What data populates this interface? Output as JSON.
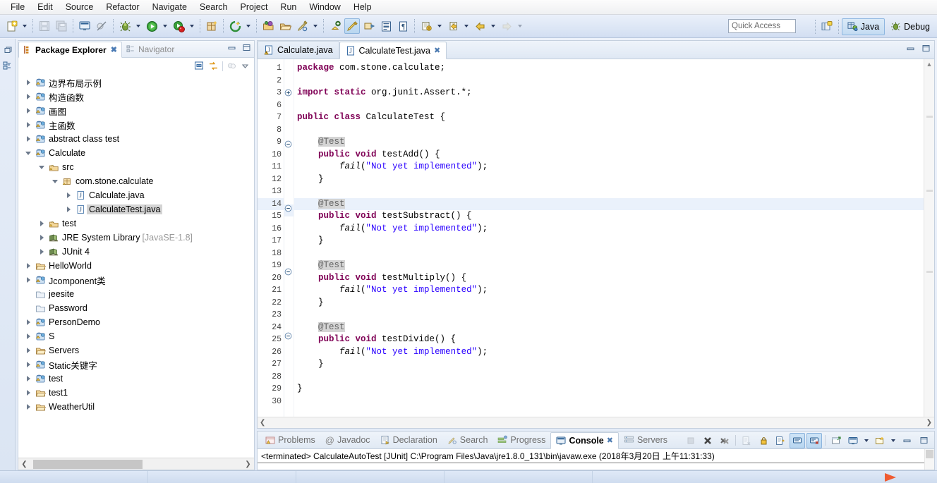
{
  "menubar": {
    "items": [
      {
        "label": "File"
      },
      {
        "label": "Edit"
      },
      {
        "label": "Source"
      },
      {
        "label": "Refactor"
      },
      {
        "label": "Navigate"
      },
      {
        "label": "Search"
      },
      {
        "label": "Project"
      },
      {
        "label": "Run"
      },
      {
        "label": "Window"
      },
      {
        "label": "Help"
      }
    ]
  },
  "toolbar": {
    "quick_access_placeholder": "Quick Access",
    "perspectives": [
      {
        "label": "Java",
        "icon": "java-perspective-icon",
        "active": true
      },
      {
        "label": "Debug",
        "icon": "debug-perspective-icon",
        "active": false
      }
    ],
    "open_perspective_icon": "open-perspective-icon",
    "buttons": [
      {
        "name": "new-wizard-icon"
      },
      {
        "name": "save-icon"
      },
      {
        "name": "save-all-icon"
      },
      {
        "name": "new-java-console-icon"
      },
      {
        "name": "skip-all-breakpoints-icon"
      },
      {
        "name": "debug-icon"
      },
      {
        "name": "run-icon"
      },
      {
        "name": "run-coverage-icon"
      },
      {
        "name": "new-java-package-icon"
      },
      {
        "name": "external-tools-icon"
      },
      {
        "name": "open-type-icon"
      },
      {
        "name": "open-task-icon"
      },
      {
        "name": "search-icon"
      },
      {
        "name": "next-annotation-icon"
      },
      {
        "name": "toggle-mark-occurrences-icon"
      },
      {
        "name": "toggle-block-selection-icon"
      },
      {
        "name": "show-whitespace-icon"
      },
      {
        "name": "pin-editor-icon"
      },
      {
        "name": "last-edit-location-icon"
      },
      {
        "name": "back-icon"
      },
      {
        "name": "forward-icon"
      }
    ]
  },
  "package_explorer": {
    "tabs": [
      {
        "label": "Package Explorer",
        "active": true,
        "icon": "package-explorer-icon"
      },
      {
        "label": "Navigator",
        "active": false,
        "icon": "navigator-icon"
      }
    ],
    "view_controls": [
      {
        "name": "minimize-view-icon"
      },
      {
        "name": "maximize-view-icon"
      }
    ],
    "toolbar_buttons": [
      {
        "name": "collapse-all-icon"
      },
      {
        "name": "link-with-editor-icon"
      },
      {
        "name": "focus-on-active-task-icon"
      },
      {
        "name": "view-menu-icon"
      }
    ],
    "tree": [
      {
        "label": "边界布局示例",
        "depth": 0,
        "state": "collapsed",
        "icon": "java-project-icon"
      },
      {
        "label": "构造函数",
        "depth": 0,
        "state": "collapsed",
        "icon": "java-project-icon"
      },
      {
        "label": "画图",
        "depth": 0,
        "state": "collapsed",
        "icon": "java-project-icon"
      },
      {
        "label": "主函数",
        "depth": 0,
        "state": "collapsed",
        "icon": "java-project-icon"
      },
      {
        "label": "abstract class test",
        "depth": 0,
        "state": "collapsed",
        "icon": "java-project-icon"
      },
      {
        "label": "Calculate",
        "depth": 0,
        "state": "expanded",
        "icon": "java-project-icon"
      },
      {
        "label": "src",
        "depth": 1,
        "state": "expanded",
        "icon": "source-folder-icon"
      },
      {
        "label": "com.stone.calculate",
        "depth": 2,
        "state": "expanded",
        "icon": "package-icon"
      },
      {
        "label": "Calculate.java",
        "depth": 3,
        "state": "collapsed",
        "icon": "java-file-icon"
      },
      {
        "label": "CalculateTest.java",
        "depth": 3,
        "state": "collapsed",
        "icon": "java-file-icon",
        "selected": true
      },
      {
        "label": "test",
        "depth": 1,
        "state": "collapsed",
        "icon": "source-folder-icon"
      },
      {
        "label": "JRE System Library",
        "suffix": "[JavaSE-1.8]",
        "depth": 1,
        "state": "collapsed",
        "icon": "library-icon"
      },
      {
        "label": "JUnit 4",
        "depth": 1,
        "state": "collapsed",
        "icon": "library-icon"
      },
      {
        "label": "HelloWorld",
        "depth": 0,
        "state": "collapsed",
        "icon": "project-icon"
      },
      {
        "label": "Jcomponent类",
        "depth": 0,
        "state": "collapsed",
        "icon": "java-project-icon"
      },
      {
        "label": "jeesite",
        "depth": 0,
        "state": "none",
        "icon": "closed-project-icon"
      },
      {
        "label": "Password",
        "depth": 0,
        "state": "none",
        "icon": "closed-project-icon"
      },
      {
        "label": "PersonDemo",
        "depth": 0,
        "state": "collapsed",
        "icon": "java-project-icon"
      },
      {
        "label": "S",
        "depth": 0,
        "state": "collapsed",
        "icon": "java-project-icon"
      },
      {
        "label": "Servers",
        "depth": 0,
        "state": "collapsed",
        "icon": "project-icon"
      },
      {
        "label": "Static关键字",
        "depth": 0,
        "state": "collapsed",
        "icon": "java-project-icon"
      },
      {
        "label": "test",
        "depth": 0,
        "state": "collapsed",
        "icon": "java-project-icon"
      },
      {
        "label": "test1",
        "depth": 0,
        "state": "collapsed",
        "icon": "project-icon"
      },
      {
        "label": "WeatherUtil",
        "depth": 0,
        "state": "collapsed",
        "icon": "project-icon"
      }
    ]
  },
  "editor": {
    "tabs": [
      {
        "label": "Calculate.java",
        "active": false,
        "icon": "java-file-warning-icon",
        "closable": false
      },
      {
        "label": "CalculateTest.java",
        "active": true,
        "icon": "java-file-icon",
        "closable": true
      }
    ],
    "controls": [
      {
        "name": "minimize-editor-icon"
      },
      {
        "name": "maximize-editor-icon"
      }
    ],
    "lines": [
      {
        "num": "1",
        "fold": "",
        "highlight": false,
        "tokens": [
          {
            "t": "package ",
            "c": "kw"
          },
          {
            "t": "com.stone.calculate;",
            "c": "plain"
          }
        ]
      },
      {
        "num": "2",
        "fold": "",
        "highlight": false,
        "tokens": []
      },
      {
        "num": "3",
        "fold": "+",
        "highlight": false,
        "tokens": [
          {
            "t": "import static ",
            "c": "kw"
          },
          {
            "t": "org.junit.Assert.*;",
            "c": "plain"
          }
        ]
      },
      {
        "num": "6",
        "fold": "",
        "highlight": false,
        "tokens": []
      },
      {
        "num": "7",
        "fold": "",
        "highlight": false,
        "tokens": [
          {
            "t": "public class ",
            "c": "kw"
          },
          {
            "t": "CalculateTest {",
            "c": "plain"
          }
        ]
      },
      {
        "num": "8",
        "fold": "",
        "highlight": false,
        "tokens": []
      },
      {
        "num": "9",
        "fold": "-",
        "highlight": false,
        "tokens": [
          {
            "t": "    ",
            "c": "plain"
          },
          {
            "t": "@Test",
            "c": "ann"
          }
        ]
      },
      {
        "num": "10",
        "fold": "",
        "highlight": false,
        "tokens": [
          {
            "t": "    ",
            "c": "plain"
          },
          {
            "t": "public void ",
            "c": "kw"
          },
          {
            "t": "testAdd() {",
            "c": "plain"
          }
        ]
      },
      {
        "num": "11",
        "fold": "",
        "highlight": false,
        "tokens": [
          {
            "t": "        ",
            "c": "plain"
          },
          {
            "t": "fail",
            "c": "mth"
          },
          {
            "t": "(",
            "c": "plain"
          },
          {
            "t": "\"Not yet implemented\"",
            "c": "str"
          },
          {
            "t": ");",
            "c": "plain"
          }
        ]
      },
      {
        "num": "12",
        "fold": "",
        "highlight": false,
        "tokens": [
          {
            "t": "    }",
            "c": "plain"
          }
        ]
      },
      {
        "num": "13",
        "fold": "",
        "highlight": false,
        "tokens": []
      },
      {
        "num": "14",
        "fold": "-",
        "highlight": true,
        "tokens": [
          {
            "t": "    ",
            "c": "plain"
          },
          {
            "t": "@Test",
            "c": "ann"
          }
        ]
      },
      {
        "num": "15",
        "fold": "",
        "highlight": false,
        "tokens": [
          {
            "t": "    ",
            "c": "plain"
          },
          {
            "t": "public void ",
            "c": "kw"
          },
          {
            "t": "testSubstract() {",
            "c": "plain"
          }
        ]
      },
      {
        "num": "16",
        "fold": "",
        "highlight": false,
        "tokens": [
          {
            "t": "        ",
            "c": "plain"
          },
          {
            "t": "fail",
            "c": "mth"
          },
          {
            "t": "(",
            "c": "plain"
          },
          {
            "t": "\"Not yet implemented\"",
            "c": "str"
          },
          {
            "t": ");",
            "c": "plain"
          }
        ]
      },
      {
        "num": "17",
        "fold": "",
        "highlight": false,
        "tokens": [
          {
            "t": "    }",
            "c": "plain"
          }
        ]
      },
      {
        "num": "18",
        "fold": "",
        "highlight": false,
        "tokens": []
      },
      {
        "num": "19",
        "fold": "-",
        "highlight": false,
        "tokens": [
          {
            "t": "    ",
            "c": "plain"
          },
          {
            "t": "@Test",
            "c": "ann"
          }
        ]
      },
      {
        "num": "20",
        "fold": "",
        "highlight": false,
        "tokens": [
          {
            "t": "    ",
            "c": "plain"
          },
          {
            "t": "public void ",
            "c": "kw"
          },
          {
            "t": "testMultiply() {",
            "c": "plain"
          }
        ]
      },
      {
        "num": "21",
        "fold": "",
        "highlight": false,
        "tokens": [
          {
            "t": "        ",
            "c": "plain"
          },
          {
            "t": "fail",
            "c": "mth"
          },
          {
            "t": "(",
            "c": "plain"
          },
          {
            "t": "\"Not yet implemented\"",
            "c": "str"
          },
          {
            "t": ");",
            "c": "plain"
          }
        ]
      },
      {
        "num": "22",
        "fold": "",
        "highlight": false,
        "tokens": [
          {
            "t": "    }",
            "c": "plain"
          }
        ]
      },
      {
        "num": "23",
        "fold": "",
        "highlight": false,
        "tokens": []
      },
      {
        "num": "24",
        "fold": "-",
        "highlight": false,
        "tokens": [
          {
            "t": "    ",
            "c": "plain"
          },
          {
            "t": "@Test",
            "c": "ann"
          }
        ]
      },
      {
        "num": "25",
        "fold": "",
        "highlight": false,
        "tokens": [
          {
            "t": "    ",
            "c": "plain"
          },
          {
            "t": "public void ",
            "c": "kw"
          },
          {
            "t": "testDivide() {",
            "c": "plain"
          }
        ]
      },
      {
        "num": "26",
        "fold": "",
        "highlight": false,
        "tokens": [
          {
            "t": "        ",
            "c": "plain"
          },
          {
            "t": "fail",
            "c": "mth"
          },
          {
            "t": "(",
            "c": "plain"
          },
          {
            "t": "\"Not yet implemented\"",
            "c": "str"
          },
          {
            "t": ");",
            "c": "plain"
          }
        ]
      },
      {
        "num": "27",
        "fold": "",
        "highlight": false,
        "tokens": [
          {
            "t": "    }",
            "c": "plain"
          }
        ]
      },
      {
        "num": "28",
        "fold": "",
        "highlight": false,
        "tokens": []
      },
      {
        "num": "29",
        "fold": "",
        "highlight": false,
        "tokens": [
          {
            "t": "}",
            "c": "plain"
          }
        ]
      },
      {
        "num": "30",
        "fold": "",
        "highlight": false,
        "tokens": []
      }
    ]
  },
  "console_panel": {
    "tabs": [
      {
        "label": "Problems",
        "active": false,
        "icon": "problems-icon"
      },
      {
        "label": "Javadoc",
        "active": false,
        "icon": "javadoc-icon"
      },
      {
        "label": "Declaration",
        "active": false,
        "icon": "declaration-icon"
      },
      {
        "label": "Search",
        "active": false,
        "icon": "search-icon"
      },
      {
        "label": "Progress",
        "active": false,
        "icon": "progress-icon"
      },
      {
        "label": "Console",
        "active": true,
        "icon": "console-icon"
      },
      {
        "label": "Servers",
        "active": false,
        "icon": "servers-icon"
      }
    ],
    "tools": [
      {
        "name": "terminate-icon",
        "disabled": true
      },
      {
        "name": "remove-launch-icon",
        "disabled": false
      },
      {
        "name": "remove-all-terminated-icon",
        "disabled": false
      },
      {
        "name": "clear-console-icon",
        "disabled": true
      },
      {
        "name": "scroll-lock-icon",
        "disabled": false
      },
      {
        "name": "word-wrap-icon",
        "disabled": false
      },
      {
        "name": "show-console-on-output-icon",
        "disabled": false,
        "toggled": true
      },
      {
        "name": "show-console-on-error-icon",
        "disabled": false,
        "toggled": true
      },
      {
        "name": "pin-console-icon",
        "disabled": false
      },
      {
        "name": "display-selected-console-icon",
        "disabled": false
      },
      {
        "name": "open-console-icon",
        "disabled": false
      },
      {
        "name": "minimize-console-icon",
        "disabled": false
      },
      {
        "name": "maximize-console-icon",
        "disabled": false
      }
    ],
    "output": "<terminated> CalculateAutoTest [JUnit] C:\\Program Files\\Java\\jre1.8.0_131\\bin\\javaw.exe (2018年3月20日 上午11:31:33)"
  },
  "fastview": {
    "items": [
      {
        "name": "restore-icon"
      },
      {
        "name": "package-explorer-fastview-icon"
      }
    ]
  },
  "colors": {
    "keyword": "#7f0055",
    "string": "#2a00ff",
    "annotation_bg": "#d4d4d4",
    "selection_bg": "#d4d4d4",
    "current_line_bg": "#eaf1fb",
    "taskbar_accent": "#ef5b31"
  }
}
